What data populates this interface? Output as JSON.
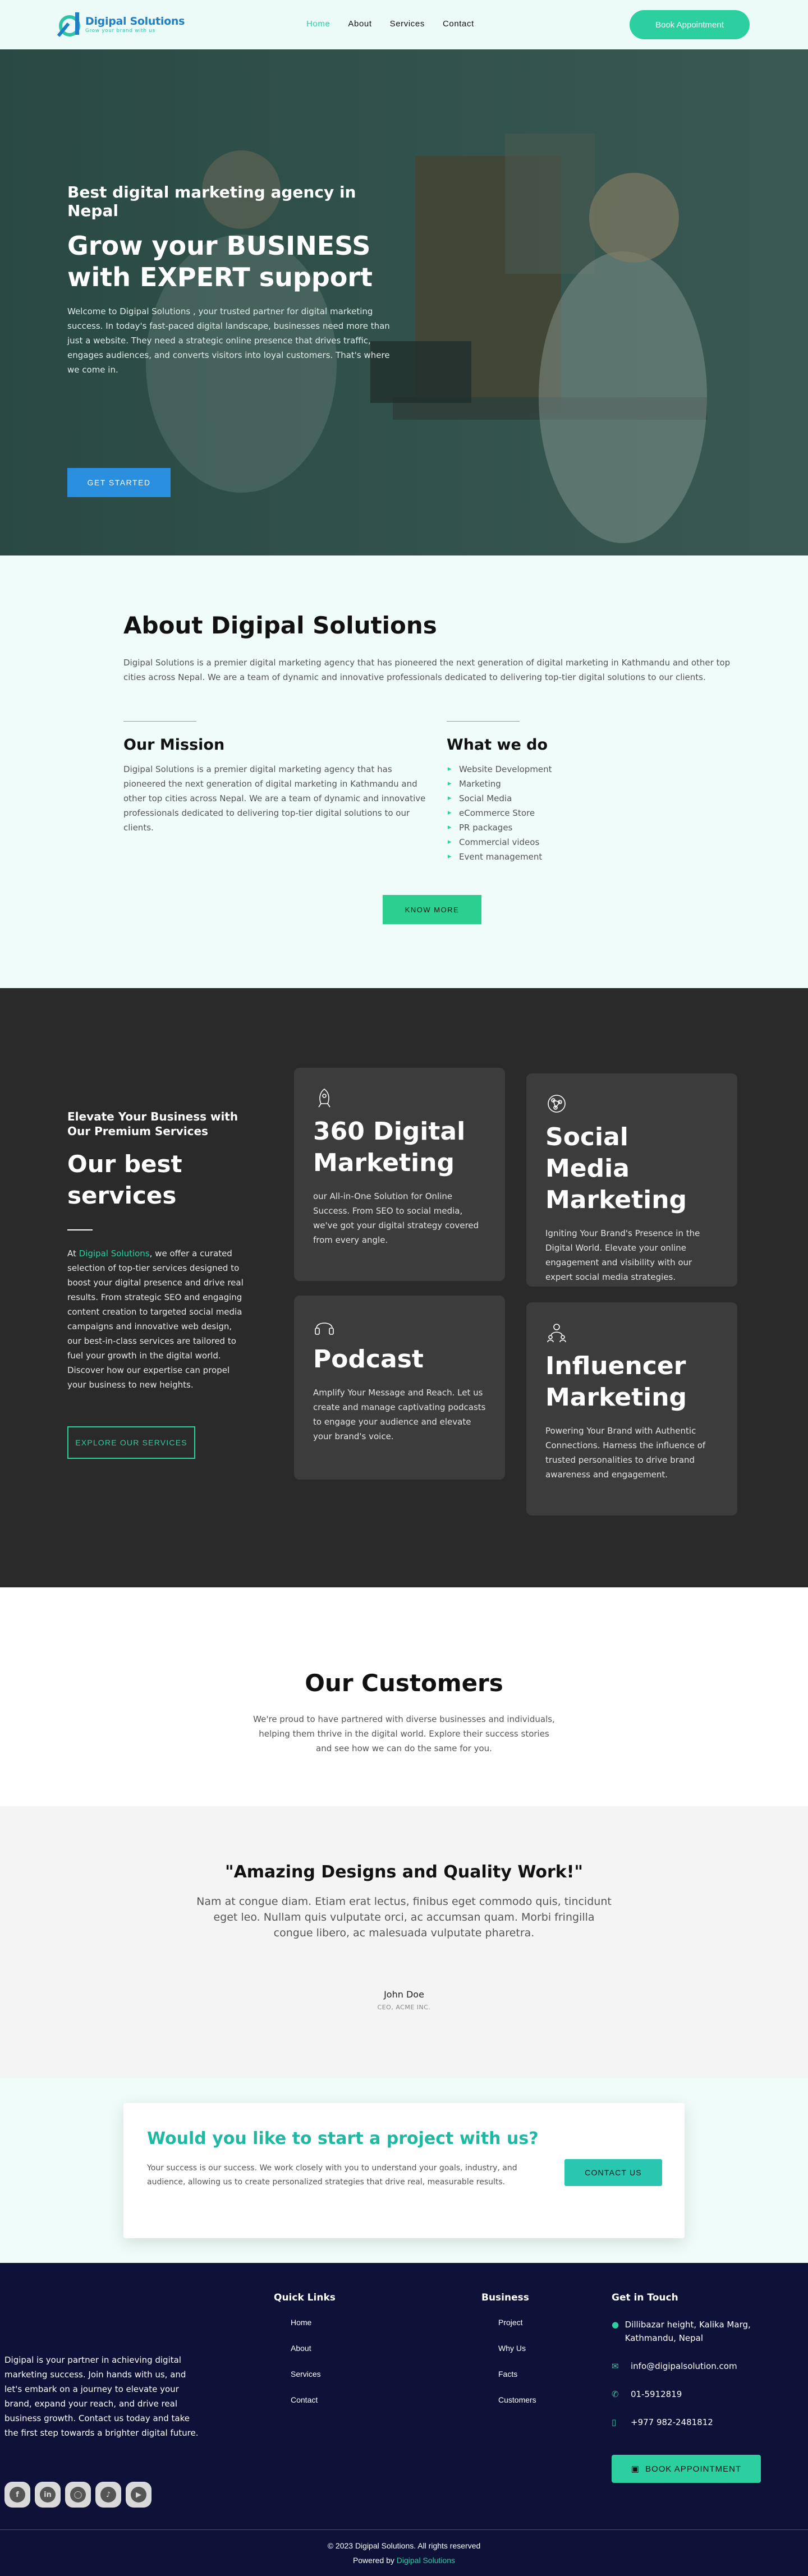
{
  "nav": {
    "logo_name": "Digipal Solutions",
    "logo_tag": "Grow your brand with us",
    "items": [
      {
        "label": "Home",
        "active": true
      },
      {
        "label": "About",
        "active": false
      },
      {
        "label": "Services",
        "active": false
      },
      {
        "label": "Contact",
        "active": false
      }
    ],
    "cta": "Book Appointment"
  },
  "hero": {
    "subtitle": "Best digital marketing agency in Nepal",
    "title_line1": "Grow your BUSINESS",
    "title_line2": "with EXPERT support",
    "text": "Welcome to Digipal Solutions , your trusted partner for digital marketing success. In today's fast-paced digital landscape, businesses need more than just a website. They need a strategic online presence that drives traffic, engages audiences, and converts visitors into loyal customers. That's where we come in.",
    "button": "GET STARTED"
  },
  "about": {
    "title": "About Digipal Solutions",
    "intro": "Digipal Solutions is a premier digital marketing agency that has pioneered the next generation of digital marketing in Kathmandu and other top cities across Nepal. We are a team of dynamic and innovative professionals dedicated to delivering top-tier digital solutions to our clients.",
    "mission_title": "Our Mission",
    "mission_text": "Digipal Solutions is a premier digital marketing agency that has pioneered the next generation of digital marketing in Kathmandu and other top cities across Nepal. We are a team of dynamic and innovative professionals dedicated to delivering top-tier digital solutions to our clients.",
    "whatwedo_title": "What we do",
    "whatwedo": [
      "Website Development",
      "Marketing",
      "Social Media",
      "eCommerce Store",
      "PR packages",
      "Commercial videos",
      "Event management"
    ],
    "button": "KNOW MORE"
  },
  "services": {
    "eyebrow": "Elevate Your Business with Our Premium Services",
    "title": "Our best services",
    "text_prefix": "At ",
    "text_highlight": "Digipal Solutions",
    "text_rest": ", we offer a curated selection of top-tier services designed to boost your digital presence and drive real results. From strategic SEO and engaging content creation to targeted social media campaigns and innovative web design, our best-in-class services are tailored to fuel your growth in the digital world. Discover how our expertise can propel your business to new heights.",
    "button": "EXPLORE OUR SERVICES",
    "cards": [
      {
        "title": "360 Digital Marketing",
        "text": "our All-in-One Solution for Online Success. From SEO to social media, we've got your digital strategy covered from every angle.",
        "icon": "rocket-icon"
      },
      {
        "title": "Social Media Marketing",
        "text": "Igniting Your Brand's Presence in the Digital World. Elevate your online engagement and visibility with our expert social media strategies.",
        "icon": "network-icon"
      },
      {
        "title": "Podcast",
        "text": "Amplify Your Message and Reach. Let us create and manage captivating podcasts to engage your audience and elevate your brand's voice.",
        "icon": "headphones-icon"
      },
      {
        "title": "Influencer Marketing",
        "text": "Powering Your Brand with Authentic Connections. Harness the influence of trusted personalities to drive brand awareness and engagement.",
        "icon": "people-icon"
      }
    ]
  },
  "customers": {
    "title": "Our Customers",
    "text": "We're proud to have partnered with diverse businesses and individuals, helping them thrive in the digital world. Explore their success stories and see how we can do the same for you."
  },
  "testimonial": {
    "quote_title": "\"Amazing Designs and Quality Work!\"",
    "quote": "Nam at congue diam. Etiam erat lectus, finibus eget commodo quis, tincidunt eget leo. Nullam quis vulputate orci, ac accumsan quam. Morbi fringilla congue libero, ac malesuada vulputate pharetra.",
    "name": "John Doe",
    "role": "CEO, ACME INC."
  },
  "cta": {
    "title": "Would you like to start a project with us?",
    "text": "Your success is our success. We work closely with you to understand your goals, industry, and audience, allowing us to create personalized strategies that drive real, measurable results.",
    "button": "CONTACT US"
  },
  "footer": {
    "about": "Digipal is your partner in achieving digital marketing success. Join hands with us, and let's embark on a journey to elevate your brand, expand your reach, and drive real business growth. Contact us today and take the first step towards a brighter digital future.",
    "socials": [
      "facebook-icon",
      "linkedin-icon",
      "instagram-icon",
      "tiktok-icon",
      "youtube-icon"
    ],
    "quick_links_title": "Quick Links",
    "quick_links": [
      "Home",
      "About",
      "Services",
      "Contact"
    ],
    "business_title": "Business",
    "business_links": [
      "Project",
      "Why Us",
      "Facts",
      "Customers"
    ],
    "touch_title": "Get in Touch",
    "address": "Dillibazar height, Kalika Marg, Kathmandu, Nepal",
    "email": "info@digipalsolution.com",
    "phone": "01-5912819",
    "mobile": "+977 982-2481812",
    "button": "BOOK APPOINTMENT",
    "copyright": "© 2023 Digipal Solutions. All rights reserved",
    "powered_prefix": "Powered by ",
    "powered_name": "Digipal Solutions"
  },
  "colors": {
    "accent": "#2bcfa0",
    "brand_blue": "#1e7fc4",
    "hero_button": "#2b8fe0",
    "footer_bg": "#0e1238",
    "services_bg": "#2a2a2a"
  }
}
